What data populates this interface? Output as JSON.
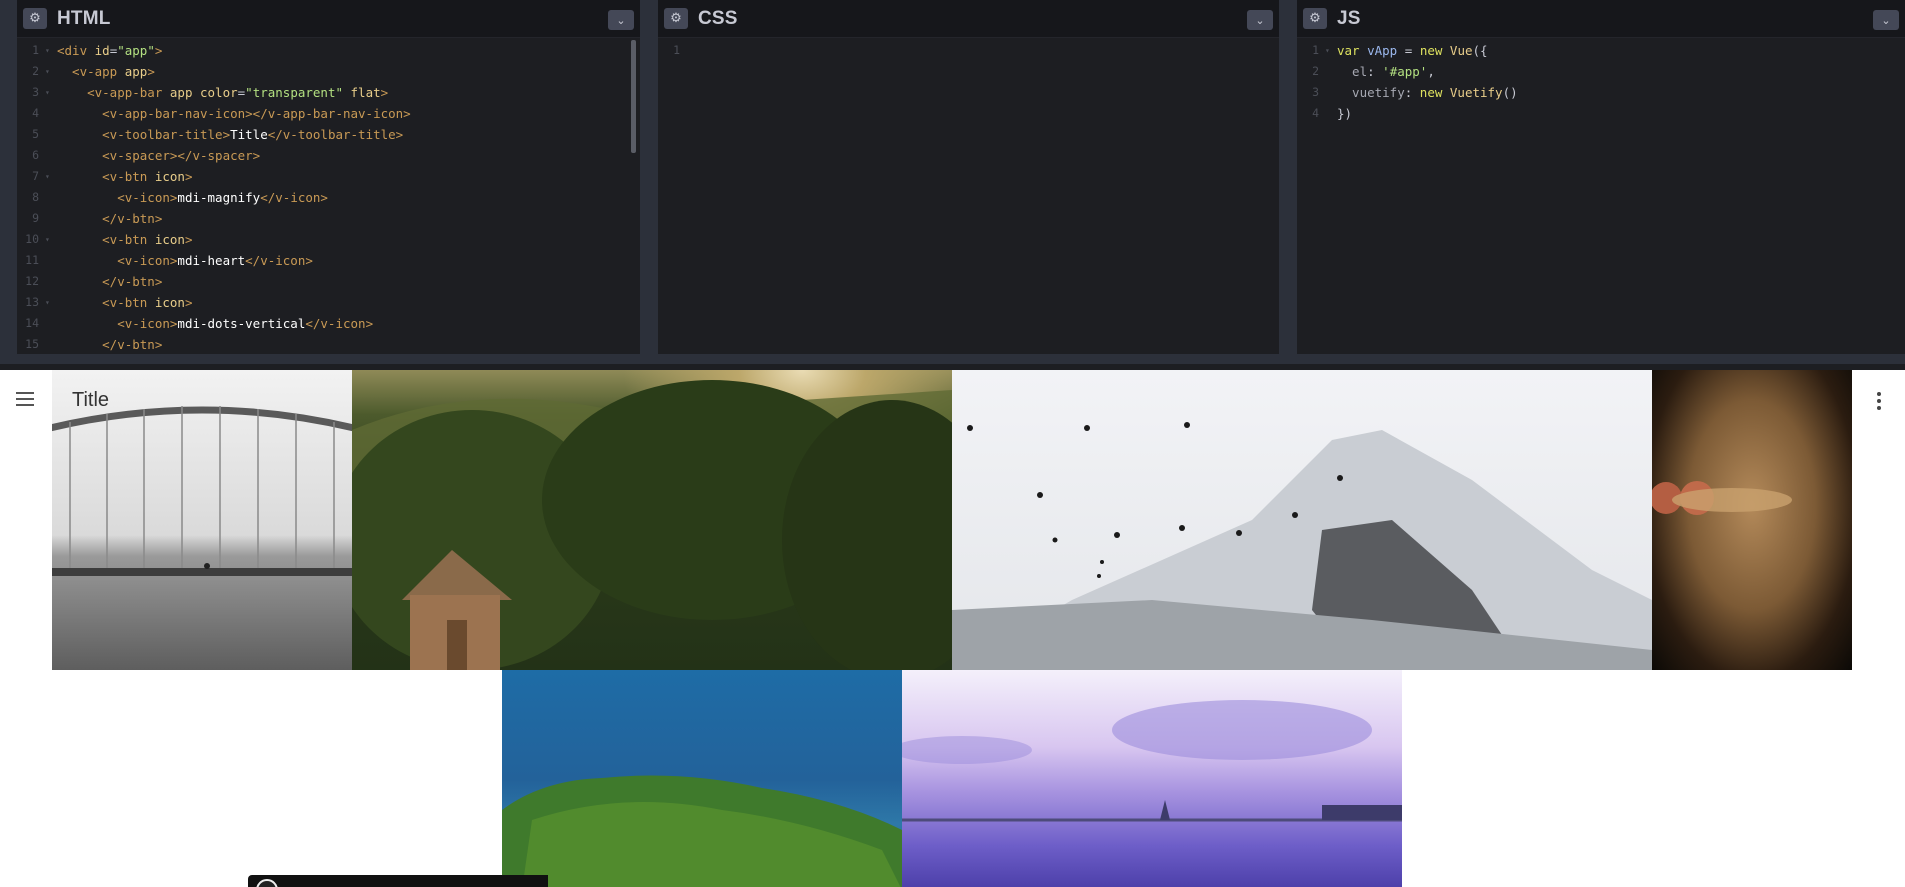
{
  "panes": {
    "html": {
      "title": "HTML",
      "lines": [
        [
          {
            "t": "<div ",
            "c": "tag"
          },
          {
            "t": "id",
            "c": "attr"
          },
          {
            "t": "=",
            "c": "punc"
          },
          {
            "t": "\"app\"",
            "c": "str"
          },
          {
            "t": ">",
            "c": "tag"
          }
        ],
        [
          {
            "t": "  <v-app ",
            "c": "tag"
          },
          {
            "t": "app",
            "c": "attr"
          },
          {
            "t": ">",
            "c": "tag"
          }
        ],
        [
          {
            "t": "    <v-app-bar ",
            "c": "tag"
          },
          {
            "t": "app ",
            "c": "attr"
          },
          {
            "t": "color",
            "c": "attr"
          },
          {
            "t": "=",
            "c": "punc"
          },
          {
            "t": "\"transparent\" ",
            "c": "str"
          },
          {
            "t": "flat",
            "c": "attr"
          },
          {
            "t": ">",
            "c": "tag"
          }
        ],
        [
          {
            "t": "      <v-app-bar-nav-icon></v-app-bar-nav-icon>",
            "c": "tag"
          }
        ],
        [
          {
            "t": "      <v-toolbar-title>",
            "c": "tag"
          },
          {
            "t": "Title",
            "c": "text"
          },
          {
            "t": "</v-toolbar-title>",
            "c": "tag"
          }
        ],
        [
          {
            "t": "      <v-spacer></v-spacer>",
            "c": "tag"
          }
        ],
        [
          {
            "t": "      <v-btn ",
            "c": "tag"
          },
          {
            "t": "icon",
            "c": "attr"
          },
          {
            "t": ">",
            "c": "tag"
          }
        ],
        [
          {
            "t": "        <v-icon>",
            "c": "tag"
          },
          {
            "t": "mdi-magnify",
            "c": "text"
          },
          {
            "t": "</v-icon>",
            "c": "tag"
          }
        ],
        [
          {
            "t": "      </v-btn>",
            "c": "tag"
          }
        ],
        [
          {
            "t": "      <v-btn ",
            "c": "tag"
          },
          {
            "t": "icon",
            "c": "attr"
          },
          {
            "t": ">",
            "c": "tag"
          }
        ],
        [
          {
            "t": "        <v-icon>",
            "c": "tag"
          },
          {
            "t": "mdi-heart",
            "c": "text"
          },
          {
            "t": "</v-icon>",
            "c": "tag"
          }
        ],
        [
          {
            "t": "      </v-btn>",
            "c": "tag"
          }
        ],
        [
          {
            "t": "      <v-btn ",
            "c": "tag"
          },
          {
            "t": "icon",
            "c": "attr"
          },
          {
            "t": ">",
            "c": "tag"
          }
        ],
        [
          {
            "t": "        <v-icon>",
            "c": "tag"
          },
          {
            "t": "mdi-dots-vertical",
            "c": "text"
          },
          {
            "t": "</v-icon>",
            "c": "tag"
          }
        ],
        [
          {
            "t": "      </v-btn>",
            "c": "tag"
          }
        ]
      ],
      "folds": [
        1,
        2,
        3,
        7,
        10,
        13
      ]
    },
    "css": {
      "title": "CSS",
      "lines": [
        []
      ],
      "folds": []
    },
    "js": {
      "title": "JS",
      "lines": [
        [
          {
            "t": "var ",
            "c": "kw"
          },
          {
            "t": "vApp ",
            "c": "var"
          },
          {
            "t": "= ",
            "c": "punc"
          },
          {
            "t": "new ",
            "c": "kw"
          },
          {
            "t": "Vue",
            "c": "fn"
          },
          {
            "t": "({",
            "c": "punc"
          }
        ],
        [
          {
            "t": "  el",
            "c": "prop"
          },
          {
            "t": ": ",
            "c": "punc"
          },
          {
            "t": "'#app'",
            "c": "str"
          },
          {
            "t": ",",
            "c": "punc"
          }
        ],
        [
          {
            "t": "  vuetify",
            "c": "prop"
          },
          {
            "t": ": ",
            "c": "punc"
          },
          {
            "t": "new ",
            "c": "kw"
          },
          {
            "t": "Vuetify",
            "c": "fn"
          },
          {
            "t": "()",
            "c": "punc"
          }
        ],
        [
          {
            "t": "})",
            "c": "punc"
          }
        ]
      ],
      "folds": [
        1
      ]
    }
  },
  "preview": {
    "app_title": "Title",
    "nav_icon": "hamburger-menu-icon",
    "more_icon": "dots-vertical-icon"
  },
  "icons": {
    "settings": "⚙",
    "collapse": "⌄"
  },
  "colors": {
    "editor_bg": "#1d1e22",
    "header_bg": "#16171b",
    "chrome_bg": "#2c303a",
    "button_bg": "#444857"
  }
}
